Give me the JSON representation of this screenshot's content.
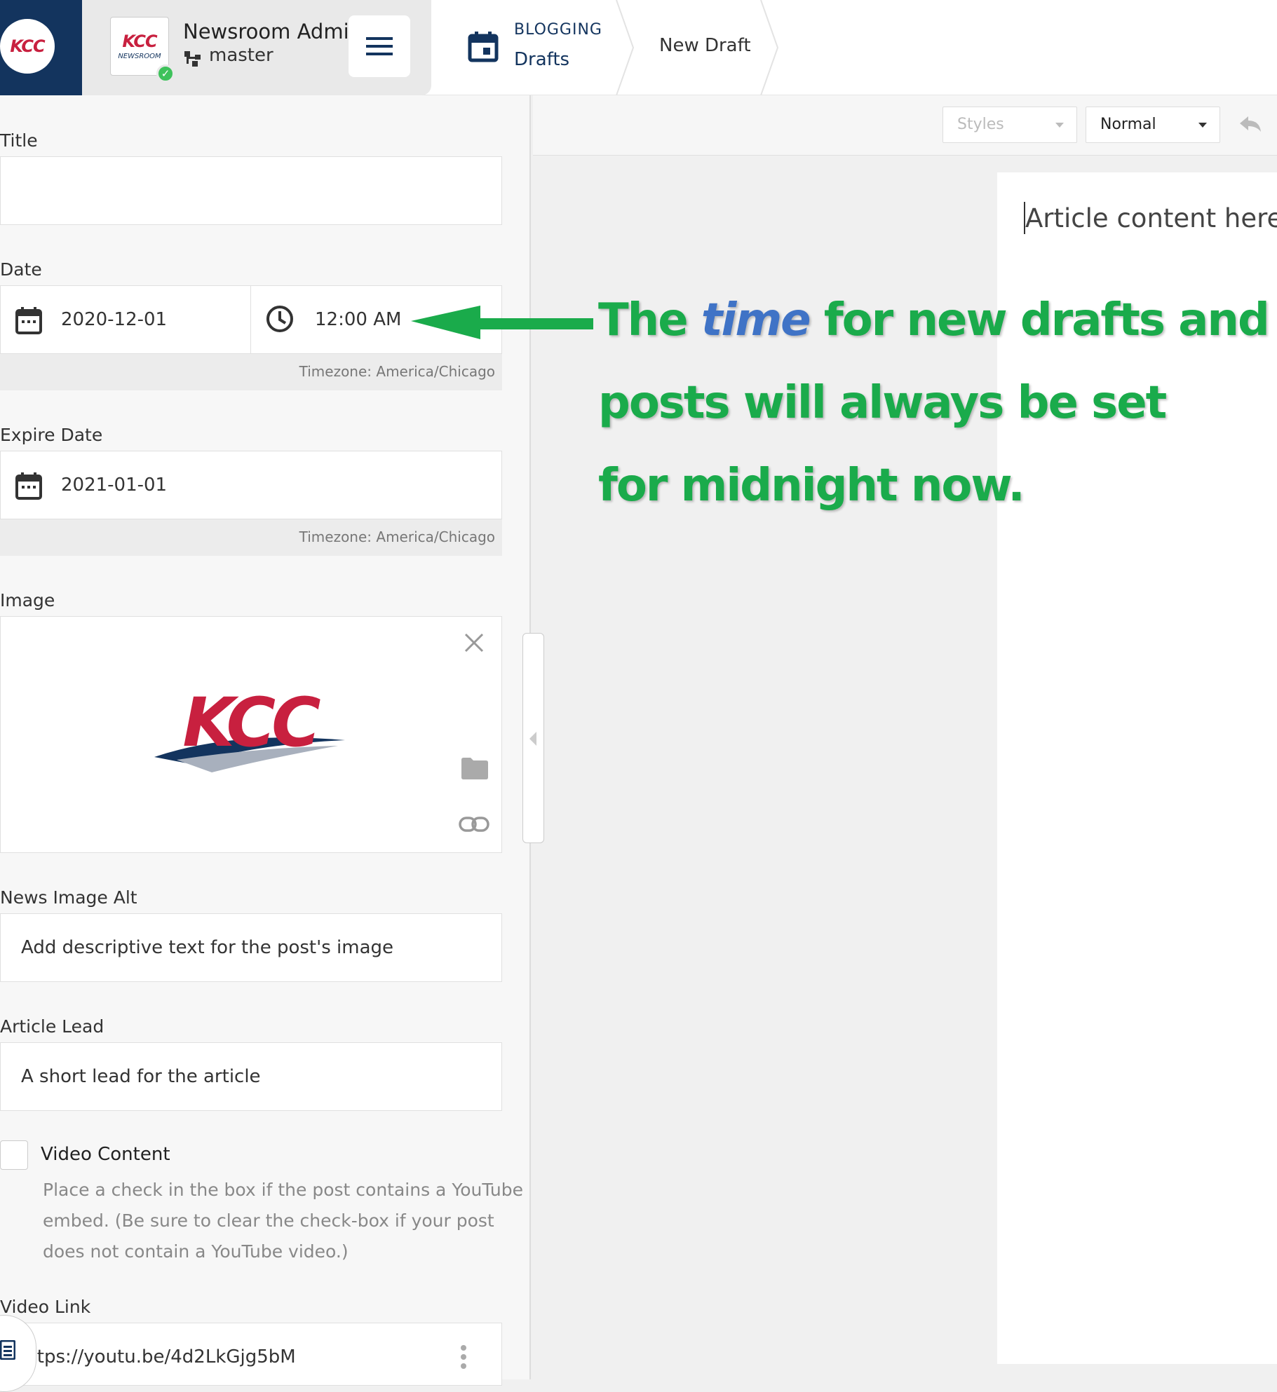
{
  "header": {
    "logo_text": "KCC",
    "site_thumb_logo": "KCC",
    "site_thumb_caption": "NEWSROOM",
    "site_name": "Newsroom Admi",
    "branch": "master",
    "status_icon": "check-circle-icon",
    "menu_icon": "hamburger-menu-icon",
    "breadcrumb": {
      "section": "BLOGGING",
      "collection": "Drafts",
      "current": "New Draft"
    }
  },
  "form": {
    "title_label": "Title",
    "title_value": "",
    "date_label": "Date",
    "date_value": "2020-12-01",
    "time_value": "12:00 AM",
    "date_timezone": "Timezone: America/Chicago",
    "expire_label": "Expire Date",
    "expire_value": "2021-01-01",
    "expire_timezone": "Timezone: America/Chicago",
    "image_label": "Image",
    "image_logo_text": "KCC",
    "image_alt_label": "News Image Alt",
    "image_alt_placeholder": "Add descriptive text for the post's image",
    "lead_label": "Article Lead",
    "lead_placeholder": "A short lead for the article",
    "video_content_label": "Video Content",
    "video_content_checked": false,
    "video_content_help": [
      "Place a check in the box if the post contains a YouTube",
      "embed. (Be sure to clear the check-box if your post",
      "does not contain a YouTube video.)"
    ],
    "video_link_label": "Video Link",
    "video_link_value": ":tps://youtu.be/4d2LkGjg5bM"
  },
  "editor": {
    "styles_placeholder": "Styles",
    "format_value": "Normal",
    "content_placeholder": "Article content here"
  },
  "annotation": {
    "line1_pre": "The ",
    "line1_em": "time",
    "line1_post": " for new drafts and",
    "line2": "posts will always be  set",
    "line3": "for midnight now."
  },
  "colors": {
    "navy": "#13345e",
    "brand_red": "#c8203f",
    "annotation_green": "#1aab4b",
    "annotation_blue": "#3f73c6",
    "status_green": "#3ec25b"
  }
}
